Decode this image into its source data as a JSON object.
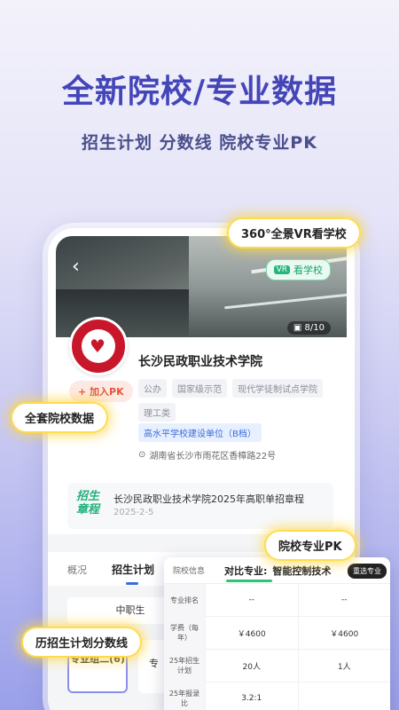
{
  "headline": "全新院校/专业数据",
  "subline": "招生计划 分数线 院校专业PK",
  "callouts": {
    "vr": "360°全景VR看学校",
    "data": "全套院校数据",
    "pk": "院校专业PK",
    "plan": "历招生计划分数线"
  },
  "hero": {
    "vr_tag": "VR",
    "vr_label": "看学校",
    "photo_count": "8/10"
  },
  "school": {
    "name": "长沙民政职业技术学院",
    "pk_label": "+ 加入PK",
    "tags": [
      "公办",
      "国家级示范",
      "现代学徒制试点学院",
      "理工类"
    ],
    "highlight_tag": "高水平学校建设单位（B档）",
    "address": "湖南省长沙市雨花区香樟路22号"
  },
  "notice": {
    "badge": "招生章程",
    "title": "长沙民政职业技术学院2025年高职单招章程",
    "date": "2025-2-5"
  },
  "tabs": [
    "概况",
    "招生计划"
  ],
  "plan": {
    "level": "中职生",
    "group1": "专业组二(6)",
    "group2_partial": "专"
  },
  "compare": {
    "col1": "院校信息",
    "col2": "对比专业:",
    "col3": "智能控制技术",
    "reselect": "重选专业",
    "rows": [
      {
        "label": "专业排名",
        "a": "--",
        "b": "--"
      },
      {
        "label": "学费（每年）",
        "a": "￥4600",
        "b": "￥4600"
      },
      {
        "label": "25年招生计划",
        "a": "20人",
        "b": "1人"
      },
      {
        "label": "25年报录比",
        "a": "3.2:1",
        "b": ""
      }
    ]
  },
  "colors": {
    "accent": "#4446b8",
    "green": "#23b27c",
    "callout_glow": "#ffd63c"
  }
}
